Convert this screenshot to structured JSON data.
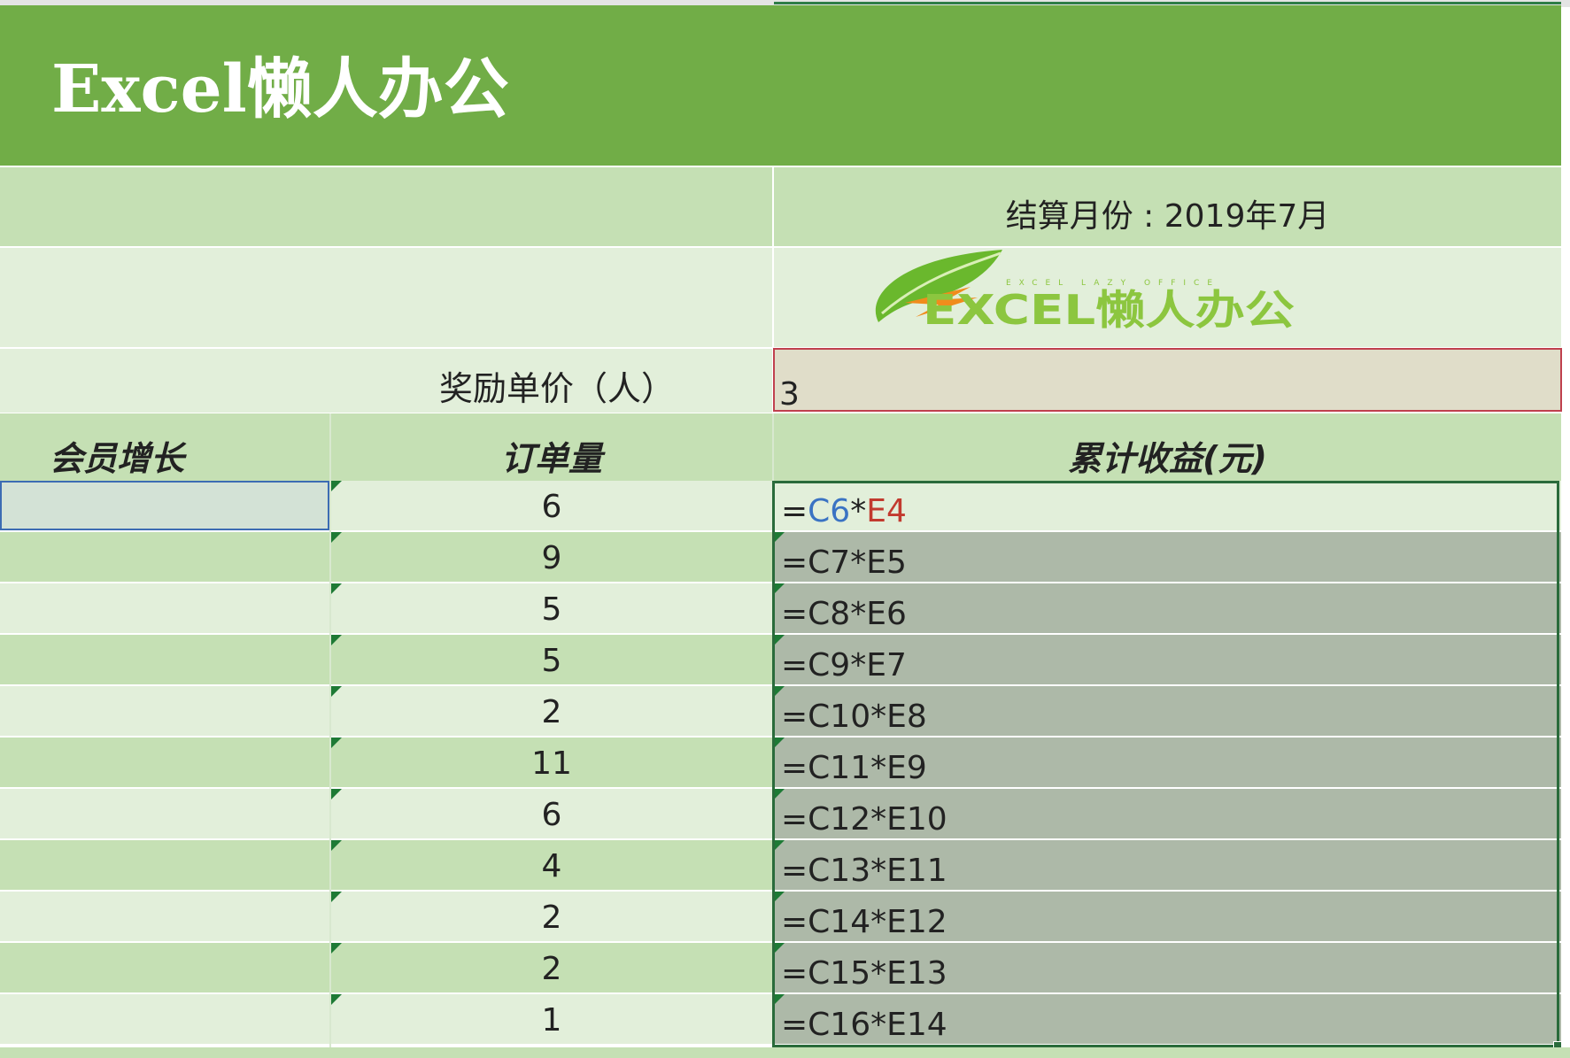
{
  "title": "Excel懒人办公",
  "settlement": {
    "label": "结算月份 : 2019年7月"
  },
  "logo": {
    "brand_text": "EXCEL懒人办公",
    "tagline": "EXCEL LAZY OFFICE",
    "colors": [
      "#6ab82d",
      "#8cc63f",
      "#f08c1c"
    ]
  },
  "reward": {
    "label": "奖励单价（人）",
    "value": "3"
  },
  "headers": {
    "member_growth": "会员增长",
    "order_qty": "订单量",
    "cumulative_income": "累计收益(元)"
  },
  "first_formula": {
    "eq": "=",
    "ref1": "C6",
    "op": "*",
    "ref2": "E4"
  },
  "rows": [
    {
      "member": "",
      "orders": "6",
      "formula": "=C6*E4"
    },
    {
      "member": "",
      "orders": "9",
      "formula": "=C7*E5"
    },
    {
      "member": "",
      "orders": "5",
      "formula": "=C8*E6"
    },
    {
      "member": "",
      "orders": "5",
      "formula": "=C9*E7"
    },
    {
      "member": "",
      "orders": "2",
      "formula": "=C10*E8"
    },
    {
      "member": "",
      "orders": "11",
      "formula": "=C11*E9"
    },
    {
      "member": "",
      "orders": "6",
      "formula": "=C12*E10"
    },
    {
      "member": "",
      "orders": "4",
      "formula": "=C13*E11"
    },
    {
      "member": "",
      "orders": "2",
      "formula": "=C14*E12"
    },
    {
      "member": "",
      "orders": "2",
      "formula": "=C15*E13"
    },
    {
      "member": "",
      "orders": "1",
      "formula": "=C16*E14"
    }
  ],
  "colors": {
    "title_band": "#71ad47",
    "band_dark": "#c5e0b4",
    "band_light": "#e2efda",
    "input_fill": "#e0ddc9",
    "input_border": "#c0404e",
    "selection_fill": "#adb9a8",
    "selection_border": "#2a6b3b",
    "ref_blue": "#3a73c3",
    "ref_red": "#c23a2e"
  }
}
